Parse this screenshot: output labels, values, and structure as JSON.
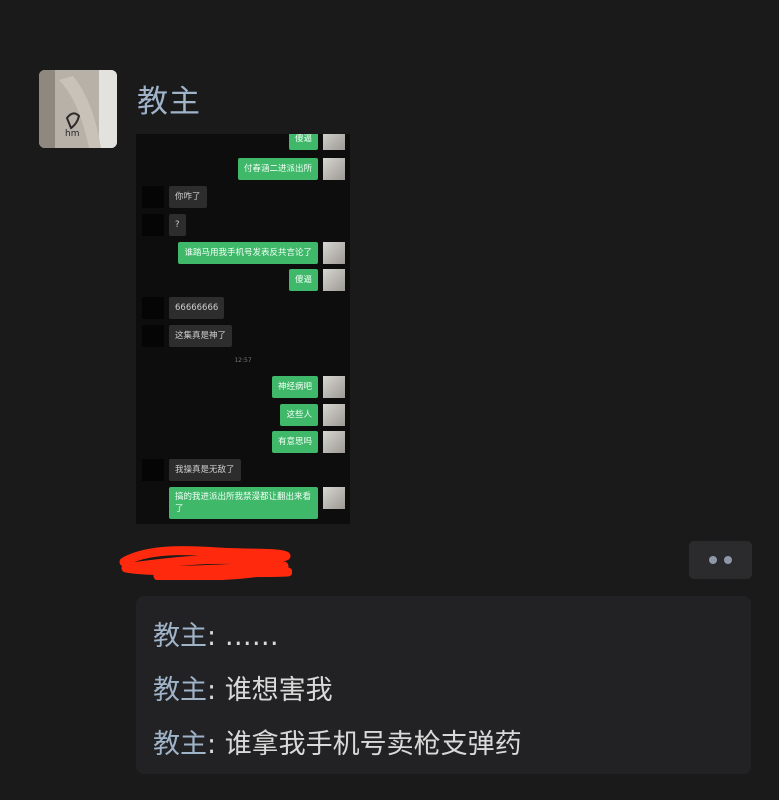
{
  "post": {
    "author": "教主"
  },
  "screenshot": {
    "messages": [
      {
        "side": "out",
        "text": "傻逼"
      },
      {
        "side": "out",
        "text": "付春涵二进派出所"
      },
      {
        "side": "in",
        "text": "你咋了"
      },
      {
        "side": "in",
        "text": "?"
      },
      {
        "side": "out",
        "text": "谁踏马用我手机号发表反共言论了"
      },
      {
        "side": "out",
        "text": "傻逼"
      },
      {
        "side": "in",
        "text": "66666666"
      },
      {
        "side": "in",
        "text": "这集真是神了"
      },
      {
        "side": "out",
        "text": "神经病吧"
      },
      {
        "side": "out",
        "text": "这些人"
      },
      {
        "side": "out",
        "text": "有意思吗"
      },
      {
        "side": "in",
        "text": "我操真是无敌了"
      },
      {
        "side": "out",
        "text": "搞的我进派出所我禁漫都让翻出来看了"
      }
    ],
    "timestamp": "12:57"
  },
  "more_button": {
    "icon": "more-dots-icon"
  },
  "comments": [
    {
      "author": "教主",
      "sep": ": ",
      "text": "……"
    },
    {
      "author": "教主",
      "sep": ": ",
      "text": "谁想害我"
    },
    {
      "author": "教主",
      "sep": ": ",
      "text": "谁拿我手机号卖枪支弹药"
    }
  ],
  "colors": {
    "background": "#1a1a1b",
    "name_blue": "#9fb3c9",
    "bubble_green": "#3fb86a",
    "redaction_red": "#ff2a0e"
  }
}
